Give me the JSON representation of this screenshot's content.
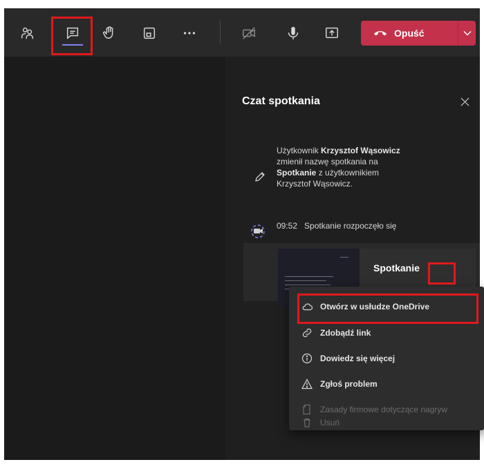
{
  "toolbar": {
    "buttons": [
      {
        "id": "participants",
        "icon": "people-icon"
      },
      {
        "id": "chat",
        "icon": "chat-icon"
      },
      {
        "id": "raise-hand",
        "icon": "hand-icon"
      },
      {
        "id": "rooms",
        "icon": "breakout-rooms-icon"
      },
      {
        "id": "more",
        "icon": "more-horizontal-icon"
      },
      {
        "id": "camera",
        "icon": "camera-off-icon"
      },
      {
        "id": "mic",
        "icon": "microphone-icon"
      },
      {
        "id": "share",
        "icon": "share-tray-icon"
      }
    ],
    "leave_label": "Opuść"
  },
  "chat": {
    "title": "Czat spotkania",
    "event_rename": {
      "p1": "Użytkownik ",
      "name1": "Krzysztof Wąsowicz",
      "p2": " zmienił nazwę spotkania na ",
      "meeting": "Spotkanie",
      "p3": " z użytkownikiem Krzysztof Wąsowicz."
    },
    "event_start": {
      "time": "09:52",
      "text": "Spotkanie rozpoczęło się"
    },
    "card_title": "Spotkanie"
  },
  "menu": {
    "items": [
      {
        "label": "Otwórz w usłudze OneDrive",
        "icon": "cloud-icon",
        "enabled": true
      },
      {
        "label": "Zdobądź link",
        "icon": "link-icon",
        "enabled": true
      },
      {
        "label": "Dowiedz się więcej",
        "icon": "info-icon",
        "enabled": true
      },
      {
        "label": "Zgłoś problem",
        "icon": "warning-icon",
        "enabled": true
      },
      {
        "label": "Zasady firmowe dotyczące nagryw",
        "icon": "document-icon",
        "enabled": false
      },
      {
        "label": "Usuń",
        "icon": "trash-icon",
        "enabled": false
      }
    ]
  },
  "colors": {
    "accent": "#c4314b",
    "highlight": "#e1181d",
    "indicator": "#7f85f5"
  }
}
